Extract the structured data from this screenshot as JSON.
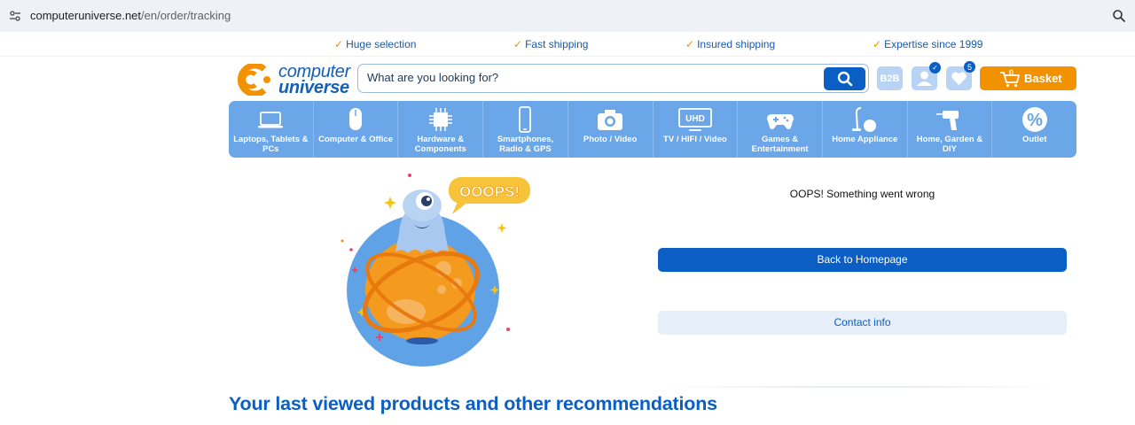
{
  "browser": {
    "url_host": "computeruniverse.net",
    "url_path": "/en/order/tracking"
  },
  "usp": [
    {
      "label": "Huge selection"
    },
    {
      "label": "Fast shipping"
    },
    {
      "label": "Insured shipping"
    },
    {
      "label": "Expertise since 1999"
    }
  ],
  "logo": {
    "line1": "computer",
    "line2": "universe"
  },
  "search": {
    "placeholder": "What are you looking for?"
  },
  "header": {
    "b2b_label": "B2B",
    "user_badge": "✓",
    "wishlist_count": "5",
    "basket_count": "0",
    "basket_label": "Basket"
  },
  "categories": [
    {
      "label": "Laptops, Tablets & PCs",
      "icon": "laptop-icon"
    },
    {
      "label": "Computer & Office",
      "icon": "mouse-icon"
    },
    {
      "label": "Hardware & Components",
      "icon": "chip-icon"
    },
    {
      "label": "Smartphones, Radio & GPS",
      "icon": "smartphone-icon"
    },
    {
      "label": "Photo / Video",
      "icon": "camera-icon"
    },
    {
      "label": "TV / HIFI / Video",
      "icon": "tv-icon"
    },
    {
      "label": "Games & Entertainment",
      "icon": "gamepad-icon"
    },
    {
      "label": "Home Appliance",
      "icon": "vacuum-icon"
    },
    {
      "label": "Home, Garden & DIY",
      "icon": "drill-icon"
    },
    {
      "label": "Outlet",
      "icon": "percent-icon"
    }
  ],
  "categories_icons": [
    "UHD"
  ],
  "error": {
    "bubble": "OOOPS!",
    "message": "OOPS! Something went wrong",
    "home_button": "Back to Homepage",
    "contact_button": "Contact info"
  },
  "recommendations": {
    "title": "Your last viewed products and other recommendations"
  },
  "colors": {
    "brand_blue": "#0b5fc4",
    "nav_blue": "#6aa6e8",
    "accent_orange": "#f39200"
  }
}
